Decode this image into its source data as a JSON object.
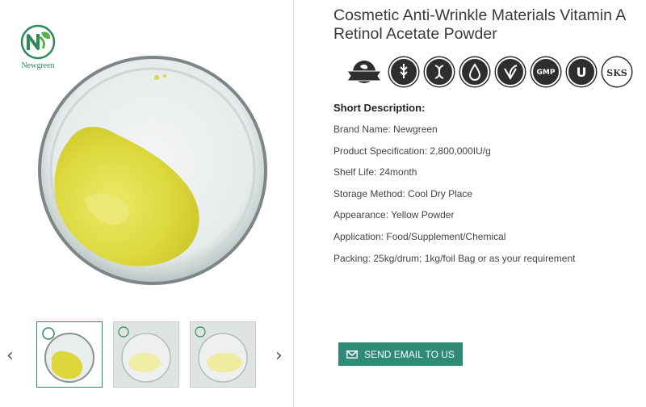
{
  "brand": {
    "logo_text": "Newgreen"
  },
  "product": {
    "title": "Cosmetic Anti-Wrinkle Materials Vitamin A Retinol Acetate Powder"
  },
  "certifications": [
    {
      "icon": "natural-ingredients-icon",
      "label": "NATURAL INGREDIENTS"
    },
    {
      "icon": "gluten-free-icon",
      "label": "GLUTEN FREE"
    },
    {
      "icon": "non-gmo-icon",
      "label": "NON GMO"
    },
    {
      "icon": "no-additives-icon",
      "label": "NO ADDITIVES"
    },
    {
      "icon": "vegan-friendly-icon",
      "label": "Vegan FRIENDLY"
    },
    {
      "icon": "gmp-icon",
      "label": "GMP"
    },
    {
      "icon": "kosher-icon",
      "label": "KOSHER"
    },
    {
      "icon": "sks-kosher-icon",
      "label": "SKS"
    }
  ],
  "description": {
    "heading": "Short Description:",
    "rows": [
      "Brand Name: Newgreen",
      "Product Specification: 2,800,000IU/g",
      "Shelf Life: 24month",
      "Storage Method: Cool Dry Place",
      "Appearance: Yellow Powder",
      "Application: Food/Supplement/Chemical",
      "Packing: 25kg/drum; 1kg/foil Bag or as your requirement"
    ]
  },
  "actions": {
    "email_label": "SEND EMAIL TO US"
  },
  "gallery": {
    "prev_icon": "chevron-left-icon",
    "next_icon": "chevron-right-icon",
    "thumbnails": [
      "thumbnail-1",
      "thumbnail-2",
      "thumbnail-3"
    ],
    "active_index": 0
  },
  "colors": {
    "accent": "#2f8a78",
    "powder": "#e3e04a",
    "logo_green": "#2f8a5a"
  }
}
